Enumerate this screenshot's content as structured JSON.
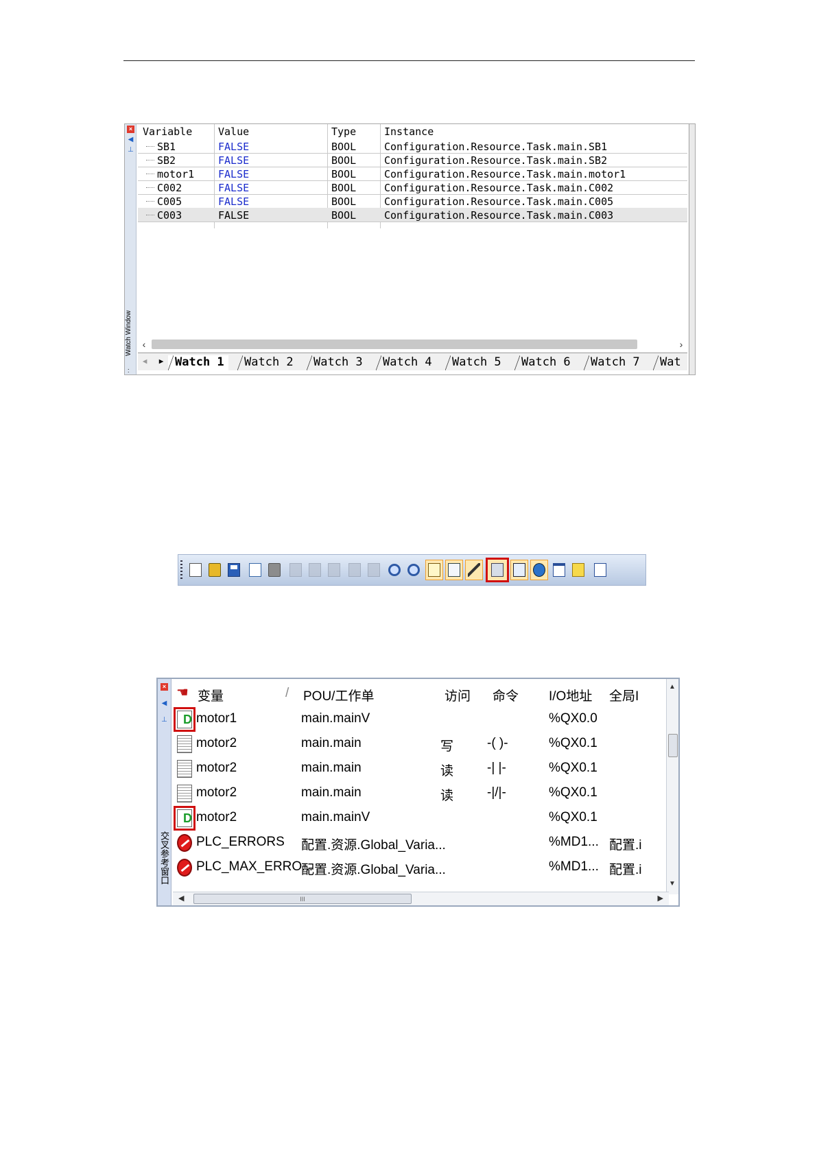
{
  "watch_window": {
    "side_title": "Watch Window",
    "columns": [
      "Variable",
      "Value",
      "Type",
      "Instance"
    ],
    "rows": [
      {
        "variable": "SB1",
        "value": "FALSE",
        "type": "BOOL",
        "instance": "Configuration.Resource.Task.main.SB1"
      },
      {
        "variable": "SB2",
        "value": "FALSE",
        "type": "BOOL",
        "instance": "Configuration.Resource.Task.main.SB2"
      },
      {
        "variable": "motor1",
        "value": "FALSE",
        "type": "BOOL",
        "instance": "Configuration.Resource.Task.main.motor1"
      },
      {
        "variable": "C002",
        "value": "FALSE",
        "type": "BOOL",
        "instance": "Configuration.Resource.Task.main.C002"
      },
      {
        "variable": "C005",
        "value": "FALSE",
        "type": "BOOL",
        "instance": "Configuration.Resource.Task.main.C005"
      },
      {
        "variable": "C003",
        "value": "FALSE",
        "type": "BOOL",
        "instance": "Configuration.Resource.Task.main.C003"
      }
    ],
    "tabs": [
      "Watch 1",
      "Watch 2",
      "Watch 3",
      "Watch 4",
      "Watch 5",
      "Watch 6",
      "Watch 7",
      "Wat"
    ],
    "selected_tab": "Watch 1",
    "colors": {
      "value_text": "#1a2bcc",
      "selected_row": "#e6e6e6"
    }
  },
  "toolbar": {
    "buttons": [
      {
        "name": "new-file-icon"
      },
      {
        "name": "open-icon"
      },
      {
        "name": "save-icon"
      },
      {
        "name": "print-preview-icon"
      },
      {
        "name": "print-icon"
      },
      {
        "name": "cut-icon"
      },
      {
        "name": "copy-icon"
      },
      {
        "name": "paste-icon"
      },
      {
        "name": "undo-icon"
      },
      {
        "name": "redo-icon"
      },
      {
        "name": "zoom-in-icon"
      },
      {
        "name": "zoom-out-icon"
      },
      {
        "name": "library-window-icon"
      },
      {
        "name": "output-window-icon"
      },
      {
        "name": "edit-wizard-icon"
      },
      {
        "name": "cross-reference-window-icon"
      },
      {
        "name": "watch-window-icon"
      },
      {
        "name": "logic-analyzer-icon"
      },
      {
        "name": "window-icon"
      },
      {
        "name": "notes-icon"
      },
      {
        "name": "properties-icon"
      }
    ],
    "highlighted": "cross-reference-window-icon",
    "highlight_color": "#d01010"
  },
  "cross_reference": {
    "side_title": "交叉参考窗口",
    "columns": [
      "变量",
      "/",
      "POU/工作单",
      "访问",
      "命令",
      "I/O地址",
      "全局I"
    ],
    "rows": [
      {
        "icon": "pagegreen",
        "framed": true,
        "variable": "motor1",
        "pou": "main.mainV",
        "access": "",
        "command": "",
        "io": "%QX0.0",
        "global": ""
      },
      {
        "icon": "page",
        "framed": false,
        "variable": "motor2",
        "pou": "main.main",
        "access": "写",
        "command": "-( )-",
        "io": "%QX0.1",
        "global": ""
      },
      {
        "icon": "page",
        "framed": false,
        "variable": "motor2",
        "pou": "main.main",
        "access": "读",
        "command": "-| |-",
        "io": "%QX0.1",
        "global": ""
      },
      {
        "icon": "page",
        "framed": false,
        "variable": "motor2",
        "pou": "main.main",
        "access": "读",
        "command": "-|/|-",
        "io": "%QX0.1",
        "global": ""
      },
      {
        "icon": "pagegreen",
        "framed": true,
        "variable": "motor2",
        "pou": "main.mainV",
        "access": "",
        "command": "",
        "io": "%QX0.1",
        "global": ""
      },
      {
        "icon": "err",
        "framed": false,
        "variable": "PLC_ERRORS",
        "pou": "配置.资源.Global_Varia...",
        "access": "",
        "command": "",
        "io": "%MD1...",
        "global": "配置.i"
      },
      {
        "icon": "err",
        "framed": false,
        "variable": "PLC_MAX_ERRO...",
        "pou": "配置.资源.Global_Varia...",
        "access": "",
        "command": "",
        "io": "%MD1...",
        "global": "配置.i"
      }
    ],
    "hscroll_thumb_label": "III"
  }
}
